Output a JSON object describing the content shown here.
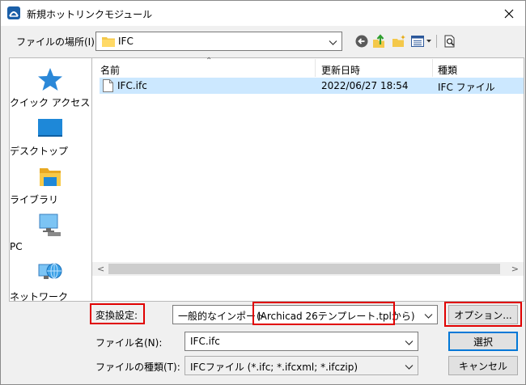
{
  "window": {
    "title": "新規ホットリンクモジュール"
  },
  "lookin": {
    "label": "ファイルの場所(I):",
    "value": "IFC"
  },
  "places": [
    {
      "label": "クイック アクセス"
    },
    {
      "label": "デスクトップ"
    },
    {
      "label": "ライブラリ"
    },
    {
      "label": "PC"
    },
    {
      "label": "ネットワーク"
    }
  ],
  "filelist": {
    "columns": {
      "name": "名前",
      "date": "更新日時",
      "type": "種類"
    },
    "rows": [
      {
        "name": "IFC.ifc",
        "date": "2022/06/27 18:54",
        "type": "IFC ファイル"
      }
    ]
  },
  "conversion": {
    "label": "変換設定:",
    "value_prefix": "一般的なインポート",
    "value_highlight": "(Archicad 26テンプレート.tplから)",
    "options_button": "オプション..."
  },
  "filename": {
    "label": "ファイル名(N):",
    "value": "IFC.ifc"
  },
  "filetype": {
    "label": "ファイルの種類(T):",
    "value": "IFCファイル (*.ifc; *.ifcxml; *.ifczip)"
  },
  "buttons": {
    "select": "選択",
    "cancel": "キャンセル"
  },
  "colors": {
    "selection": "#cce8ff",
    "highlight_box": "#e00000",
    "default_button_border": "#0078d7"
  }
}
